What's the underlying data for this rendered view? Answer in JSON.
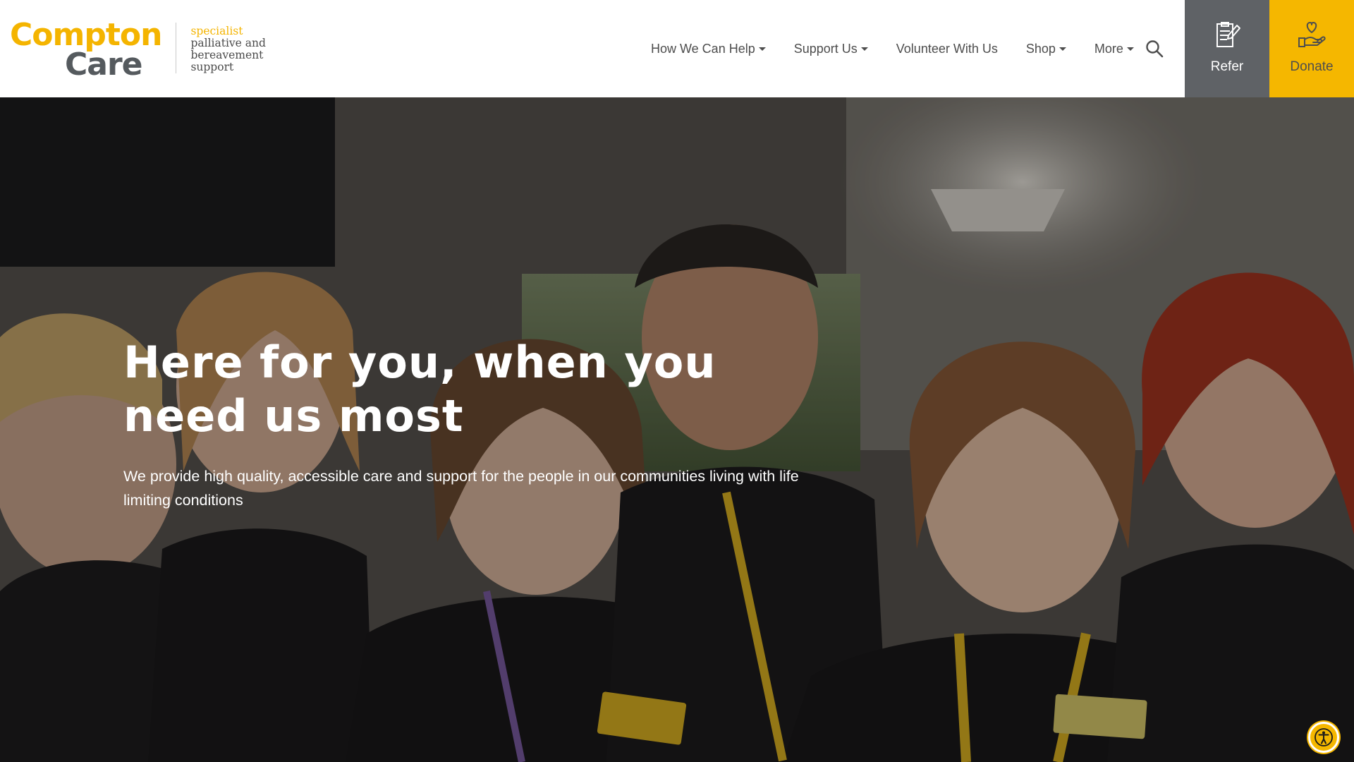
{
  "brand": {
    "name_line1": "Compton",
    "name_line2": "Care",
    "tagline_accent": "specialist",
    "tagline_line2": "palliative and",
    "tagline_line3": "bereavement",
    "tagline_line4": "support",
    "primary_color": "#f4b400",
    "secondary_color": "#555a5e"
  },
  "nav": {
    "items": [
      {
        "label": "How We Can Help",
        "has_dropdown": true
      },
      {
        "label": "Support Us",
        "has_dropdown": true
      },
      {
        "label": "Volunteer With Us",
        "has_dropdown": false
      },
      {
        "label": "Shop",
        "has_dropdown": true
      },
      {
        "label": "More",
        "has_dropdown": true
      }
    ],
    "search_icon": "search-icon"
  },
  "cta": {
    "refer": {
      "label": "Refer",
      "icon": "clipboard-pen-icon",
      "color": "#5f6266"
    },
    "donate": {
      "label": "Donate",
      "icon": "heart-hand-icon",
      "color": "#f5b700"
    }
  },
  "hero": {
    "title": "Here for you, when you need us most",
    "subtitle": "We provide high quality, accessible care and support for the people in our communities living with life limiting conditions"
  },
  "accessibility": {
    "icon": "accessibility-icon"
  }
}
